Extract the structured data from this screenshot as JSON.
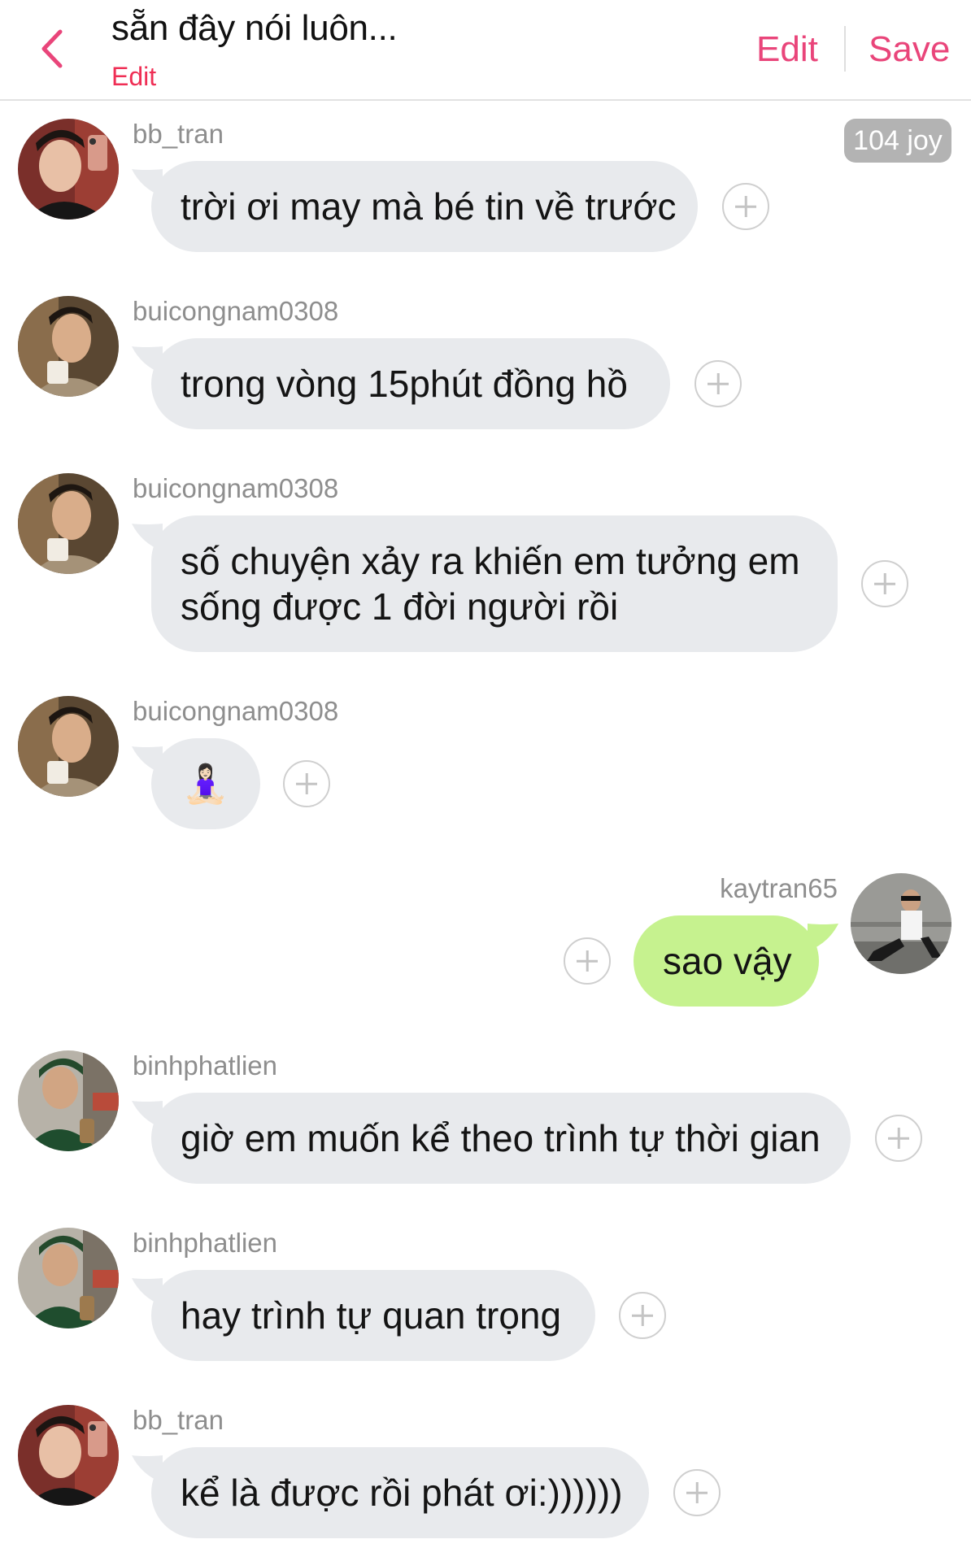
{
  "header": {
    "title": "sẵn đây nói luôn...",
    "subtitle": "Edit",
    "edit_label": "Edit",
    "save_label": "Save",
    "back_icon": "chevron-left-icon",
    "accent_color": "#e9457a"
  },
  "joy_badge": "104 joy",
  "messages": [
    {
      "username": "bb_tran",
      "text": "trời ơi may mà bé tin về trước",
      "side": "left"
    },
    {
      "username": "buicongnam0308",
      "text": "trong vòng 15phút đồng hồ",
      "side": "left"
    },
    {
      "username": "buicongnam0308",
      "text": "số chuyện xảy ra khiến em tưởng em sống được 1 đời người rồi",
      "side": "left"
    },
    {
      "username": "buicongnam0308",
      "text": "🧘🏻‍♀️",
      "side": "left"
    },
    {
      "username": "kaytran65",
      "text": "sao vậy",
      "side": "right"
    },
    {
      "username": "binhphatlien",
      "text": "giờ em muốn kể theo trình tự thời gian",
      "side": "left"
    },
    {
      "username": "binhphatlien",
      "text": "hay trình tự quan trọng",
      "side": "left"
    },
    {
      "username": "bb_tran",
      "text": "kể là được rồi phát ơi:))))))",
      "side": "left"
    }
  ],
  "colors": {
    "bubble_other": "#e8eaed",
    "bubble_mine": "#c6f28f",
    "username": "#8e8e8e",
    "badge": "#b3b3b3"
  }
}
